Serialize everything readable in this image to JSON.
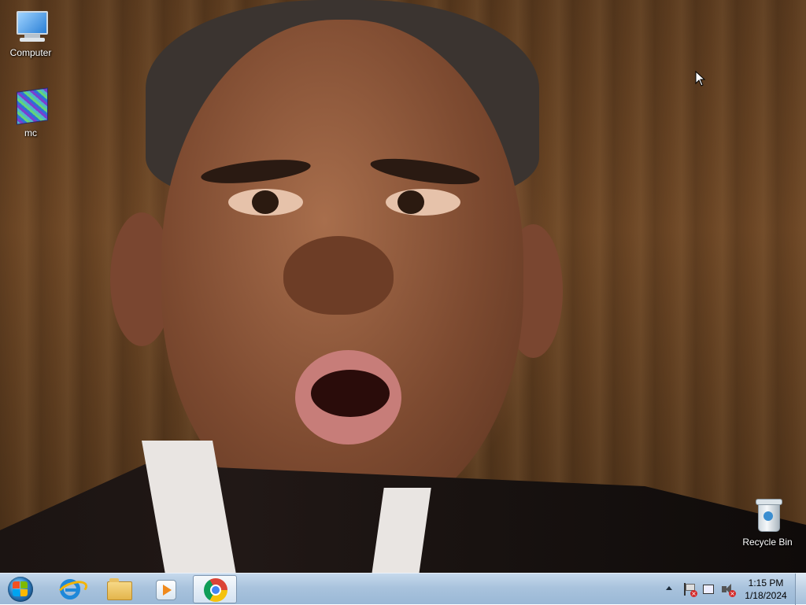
{
  "desktop": {
    "icons": [
      {
        "label": "Computer",
        "icon": "computer-icon"
      },
      {
        "label": "mc",
        "icon": "minecraft-block-icon"
      },
      {
        "label": "Recycle Bin",
        "icon": "recycle-bin-icon"
      }
    ],
    "wallpaper": "photo-portrait"
  },
  "taskbar": {
    "start": {
      "icon": "windows-start-orb-icon"
    },
    "pinned": [
      {
        "name": "Internet Explorer",
        "icon": "internet-explorer-icon",
        "active": false
      },
      {
        "name": "Windows Explorer",
        "icon": "file-explorer-icon",
        "active": false
      },
      {
        "name": "Windows Media Player",
        "icon": "media-player-icon",
        "active": false
      },
      {
        "name": "Google Chrome",
        "icon": "chrome-icon",
        "active": true
      }
    ],
    "tray": {
      "icons": [
        "show-hidden-icons-arrow",
        "action-center-flag-icon",
        "network-icon",
        "volume-muted-icon"
      ]
    },
    "clock": {
      "time": "1:15 PM",
      "date": "1/18/2024"
    }
  },
  "colors": {
    "taskbar_top": "#c6d9ec",
    "taskbar_bottom": "#9ab8d6",
    "error_badge": "#d32a2a"
  }
}
